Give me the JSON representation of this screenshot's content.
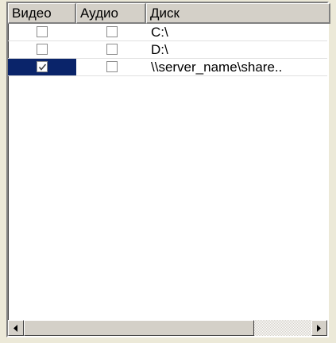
{
  "columns": {
    "video": "Видео",
    "audio": "Аудио",
    "disk": "Диск"
  },
  "rows": [
    {
      "video": false,
      "audio": false,
      "disk": "C:\\",
      "selected": false
    },
    {
      "video": false,
      "audio": false,
      "disk": "D:\\",
      "selected": false
    },
    {
      "video": true,
      "audio": false,
      "disk": "\\\\server_name\\share..",
      "selected": true
    }
  ],
  "colors": {
    "selection": "#0a246a",
    "face": "#d4d0c8"
  },
  "scrollbar": {
    "left_icon": "arrow-left-icon",
    "right_icon": "arrow-right-icon"
  }
}
